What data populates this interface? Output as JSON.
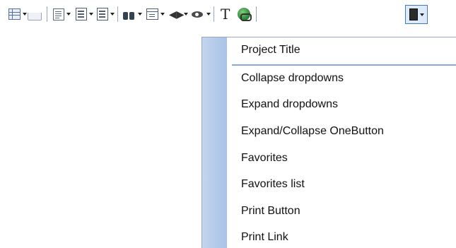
{
  "toolbar": {
    "buttons": [
      {
        "name": "grid-dropdown",
        "icon": "grid-icon",
        "has_dropdown": true
      },
      {
        "name": "tray",
        "icon": "tray-icon",
        "has_dropdown": false
      },
      {
        "name": "list-dropdown",
        "icon": "list-icon",
        "has_dropdown": true
      },
      {
        "name": "document-dropdown",
        "icon": "document-icon",
        "has_dropdown": true
      },
      {
        "name": "page-dropdown",
        "icon": "page-icon",
        "has_dropdown": true
      },
      {
        "name": "binoculars-dropdown",
        "icon": "binoculars-icon",
        "has_dropdown": true
      },
      {
        "name": "panel-dropdown",
        "icon": "panel-icon",
        "has_dropdown": true
      },
      {
        "name": "split-dropdown",
        "icon": "split-icon",
        "has_dropdown": true
      },
      {
        "name": "view-dropdown",
        "icon": "eye-icon",
        "has_dropdown": true
      },
      {
        "name": "text",
        "icon": "text-icon",
        "label": "T",
        "has_dropdown": false
      },
      {
        "name": "link",
        "icon": "globe-link-icon",
        "has_dropdown": false
      },
      {
        "name": "door-dropdown",
        "icon": "door-icon",
        "has_dropdown": true,
        "active": true
      }
    ]
  },
  "menu": {
    "header": "Project Title",
    "items": [
      "Collapse dropdowns",
      "Expand dropdowns",
      "Expand/Collapse OneButton",
      "Favorites",
      "Favorites list",
      "Print Button",
      "Print Link"
    ]
  },
  "colors": {
    "gutter": "#b5cbeb",
    "divider": "#8aa9d6",
    "active_border": "#3e77c2",
    "active_fill": "#dceafb"
  }
}
